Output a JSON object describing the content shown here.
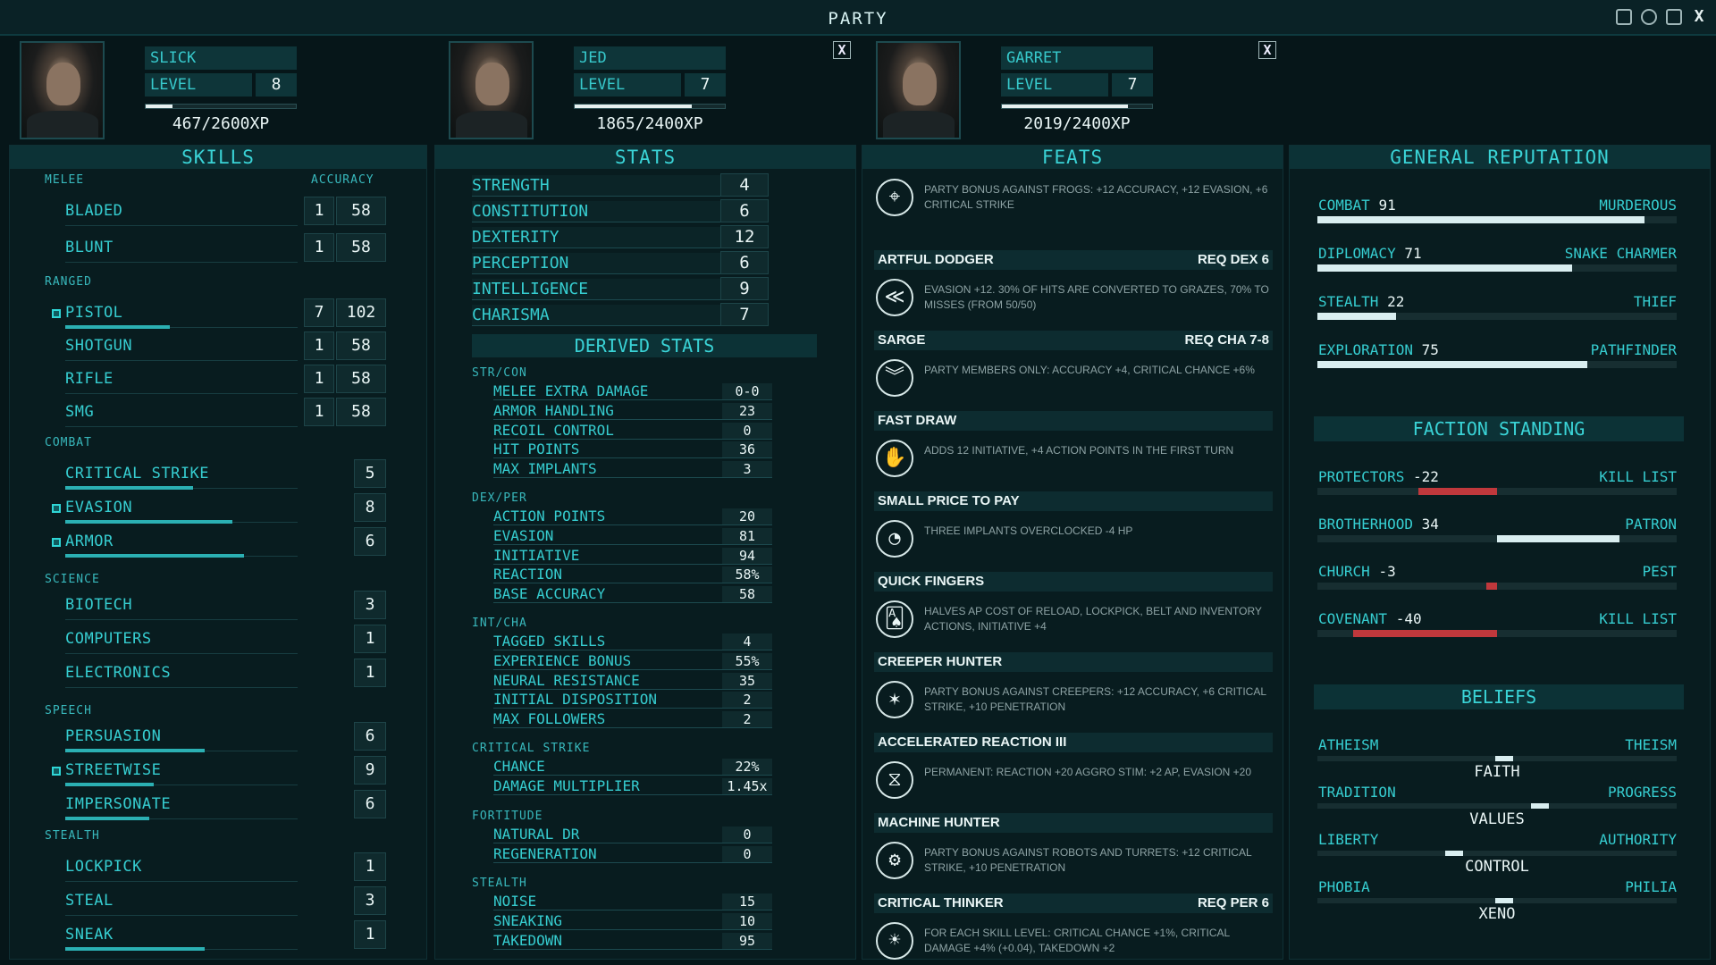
{
  "window": {
    "title": "PARTY",
    "close_label": "X"
  },
  "party": [
    {
      "name": "SLICK",
      "level_label": "LEVEL",
      "level": "8",
      "xp": "467/2600XP",
      "xp_progress": 0.18
    },
    {
      "name": "JED",
      "level_label": "LEVEL",
      "level": "7",
      "xp": "1865/2400XP",
      "xp_progress": 0.78,
      "close": "X"
    },
    {
      "name": "GARRET",
      "level_label": "LEVEL",
      "level": "7",
      "xp": "2019/2400XP",
      "xp_progress": 0.84,
      "close": "X"
    }
  ],
  "skills": {
    "title": "SKILLS",
    "accuracy_label": "ACCURACY",
    "categories": {
      "melee": "MELEE",
      "ranged": "RANGED",
      "combat": "COMBAT",
      "science": "SCIENCE",
      "speech": "SPEECH",
      "stealth": "STEALTH"
    },
    "melee": [
      {
        "name": "BLADED",
        "level": "1",
        "accuracy": "58"
      },
      {
        "name": "BLUNT",
        "level": "1",
        "accuracy": "58"
      }
    ],
    "ranged": [
      {
        "name": "PISTOL",
        "level": "7",
        "accuracy": "102",
        "tagged": true,
        "progress": 0.45
      },
      {
        "name": "SHOTGUN",
        "level": "1",
        "accuracy": "58"
      },
      {
        "name": "RIFLE",
        "level": "1",
        "accuracy": "58"
      },
      {
        "name": "SMG",
        "level": "1",
        "accuracy": "58"
      }
    ],
    "combat": [
      {
        "name": "CRITICAL STRIKE",
        "level": "5",
        "progress": 0.55
      },
      {
        "name": "EVASION",
        "level": "8",
        "tagged": true,
        "progress": 0.72
      },
      {
        "name": "ARMOR",
        "level": "6",
        "tagged": true,
        "progress": 0.77
      }
    ],
    "science": [
      {
        "name": "BIOTECH",
        "level": "3"
      },
      {
        "name": "COMPUTERS",
        "level": "1"
      },
      {
        "name": "ELECTRONICS",
        "level": "1"
      }
    ],
    "speech": [
      {
        "name": "PERSUASION",
        "level": "6",
        "progress": 0.6
      },
      {
        "name": "STREETWISE",
        "level": "9",
        "tagged": true,
        "progress": 0.38
      },
      {
        "name": "IMPERSONATE",
        "level": "6",
        "progress": 0.36
      }
    ],
    "stealth": [
      {
        "name": "LOCKPICK",
        "level": "1"
      },
      {
        "name": "STEAL",
        "level": "3"
      },
      {
        "name": "SNEAK",
        "level": "1",
        "progress": 0.6
      }
    ]
  },
  "stats": {
    "title": "STATS",
    "attributes": [
      {
        "name": "STRENGTH",
        "value": "4"
      },
      {
        "name": "CONSTITUTION",
        "value": "6"
      },
      {
        "name": "DEXTERITY",
        "value": "12"
      },
      {
        "name": "PERCEPTION",
        "value": "6"
      },
      {
        "name": "INTELLIGENCE",
        "value": "9"
      },
      {
        "name": "CHARISMA",
        "value": "7"
      }
    ],
    "derived_title": "DERIVED STATS",
    "derived": [
      {
        "group": "STR/CON",
        "rows": [
          {
            "name": "MELEE EXTRA DAMAGE",
            "value": "0-0"
          },
          {
            "name": "ARMOR HANDLING",
            "value": "23"
          },
          {
            "name": "RECOIL CONTROL",
            "value": "0"
          },
          {
            "name": "HIT POINTS",
            "value": "36"
          },
          {
            "name": "MAX IMPLANTS",
            "value": "3"
          }
        ]
      },
      {
        "group": "DEX/PER",
        "rows": [
          {
            "name": "ACTION POINTS",
            "value": "20"
          },
          {
            "name": "EVASION",
            "value": "81"
          },
          {
            "name": "INITIATIVE",
            "value": "94"
          },
          {
            "name": "REACTION",
            "value": "58%"
          },
          {
            "name": "BASE ACCURACY",
            "value": "58"
          }
        ]
      },
      {
        "group": "INT/CHA",
        "rows": [
          {
            "name": "TAGGED SKILLS",
            "value": "4"
          },
          {
            "name": "EXPERIENCE BONUS",
            "value": "55%"
          },
          {
            "name": "NEURAL RESISTANCE",
            "value": "35"
          },
          {
            "name": "INITIAL DISPOSITION",
            "value": "2"
          },
          {
            "name": "MAX FOLLOWERS",
            "value": "2"
          }
        ]
      },
      {
        "group": "CRITICAL STRIKE",
        "rows": [
          {
            "name": "CHANCE",
            "value": "22%"
          },
          {
            "name": "DAMAGE MULTIPLIER",
            "value": "1.45x"
          }
        ]
      },
      {
        "group": "FORTITUDE",
        "rows": [
          {
            "name": "NATURAL DR",
            "value": "0"
          },
          {
            "name": "REGENERATION",
            "value": "0"
          }
        ]
      },
      {
        "group": "STEALTH",
        "rows": [
          {
            "name": "NOISE",
            "value": "15"
          },
          {
            "name": "SNEAKING",
            "value": "10"
          },
          {
            "name": "TAKEDOWN",
            "value": "95"
          }
        ]
      }
    ]
  },
  "feats": {
    "title": "FEATS",
    "items": [
      {
        "title": "",
        "req": "",
        "icon": "frog-target-icon",
        "glyph": "⌖",
        "desc": "PARTY BONUS AGAINST FROGS: +12 ACCURACY, +12 EVASION, +6 CRITICAL STRIKE"
      },
      {
        "title": "ARTFUL DODGER",
        "req": "REQ DEX 6",
        "icon": "dodge-icon",
        "glyph": "≪",
        "desc": "EVASION +12. 30% OF HITS ARE CONVERTED TO GRAZES, 70% TO MISSES (FROM 50/50)"
      },
      {
        "title": "SARGE",
        "req": "REQ CHA 7-8",
        "icon": "chevron-rank-icon",
        "glyph": "︾",
        "desc": "PARTY MEMBERS ONLY: ACCURACY +4, CRITICAL CHANCE +6%"
      },
      {
        "title": "FAST DRAW",
        "req": "",
        "icon": "hand-draw-icon",
        "glyph": "✋",
        "desc": "ADDS 12 INITIATIVE, +4 ACTION POINTS IN THE FIRST TURN"
      },
      {
        "title": "SMALL PRICE TO PAY",
        "req": "",
        "icon": "gauge-icon",
        "glyph": "◔",
        "desc": "THREE IMPLANTS OVERCLOCKED -4 HP"
      },
      {
        "title": "QUICK FINGERS",
        "req": "",
        "icon": "cards-icon",
        "glyph": "🂡",
        "desc": "HALVES AP COST OF RELOAD, LOCKPICK, BELT AND INVENTORY ACTIONS, INITIATIVE +4"
      },
      {
        "title": "CREEPER HUNTER",
        "req": "",
        "icon": "creeper-target-icon",
        "glyph": "✶",
        "desc": "PARTY BONUS AGAINST CREEPERS: +12 ACCURACY, +6 CRITICAL STRIKE, +10 PENETRATION"
      },
      {
        "title": "ACCELERATED REACTION III",
        "req": "",
        "icon": "dna-icon",
        "glyph": "⧖",
        "desc": "PERMANENT: REACTION +20 AGGRO STIM: +2 AP, EVASION +20"
      },
      {
        "title": "MACHINE HUNTER",
        "req": "",
        "icon": "robot-target-icon",
        "glyph": "⚙",
        "desc": "PARTY BONUS AGAINST ROBOTS AND TURRETS: +12 CRITICAL STRIKE, +10 PENETRATION"
      },
      {
        "title": "CRITICAL THINKER",
        "req": "REQ PER 6",
        "icon": "lightbulb-icon",
        "glyph": "☀",
        "desc": "FOR EACH SKILL LEVEL: CRITICAL CHANCE +1%, CRITICAL DAMAGE +4% (+0.04), TAKEDOWN +2"
      }
    ]
  },
  "reputation": {
    "title": "GENERAL REPUTATION",
    "items": [
      {
        "name": "COMBAT",
        "value": "91",
        "rank": "MURDEROUS",
        "fraction": 0.91
      },
      {
        "name": "DIPLOMACY",
        "value": "71",
        "rank": "SNAKE CHARMER",
        "fraction": 0.71
      },
      {
        "name": "STEALTH",
        "value": "22",
        "rank": "THIEF",
        "fraction": 0.22
      },
      {
        "name": "EXPLORATION",
        "value": "75",
        "rank": "PATHFINDER",
        "fraction": 0.75
      }
    ],
    "faction_title": "FACTION STANDING",
    "factions": [
      {
        "name": "PROTECTORS",
        "value": "-22",
        "rank": "KILL LIST",
        "score": -22
      },
      {
        "name": "BROTHERHOOD",
        "value": "34",
        "rank": "PATRON",
        "score": 34
      },
      {
        "name": "CHURCH",
        "value": "-3",
        "rank": "PEST",
        "score": -3
      },
      {
        "name": "COVENANT",
        "value": "-40",
        "rank": "KILL LIST",
        "score": -40
      }
    ],
    "beliefs_title": "BELIEFS",
    "beliefs": [
      {
        "left": "ATHEISM",
        "right": "THEISM",
        "label": "FAITH",
        "position": 0.52
      },
      {
        "left": "TRADITION",
        "right": "PROGRESS",
        "label": "VALUES",
        "position": 0.62
      },
      {
        "left": "LIBERTY",
        "right": "AUTHORITY",
        "label": "CONTROL",
        "position": 0.38
      },
      {
        "left": "PHOBIA",
        "right": "PHILIA",
        "label": "XENO",
        "position": 0.52
      }
    ]
  },
  "colors": {
    "accent": "#2fd6d6",
    "positive": "#d9eef0",
    "negative": "#c0383c"
  }
}
